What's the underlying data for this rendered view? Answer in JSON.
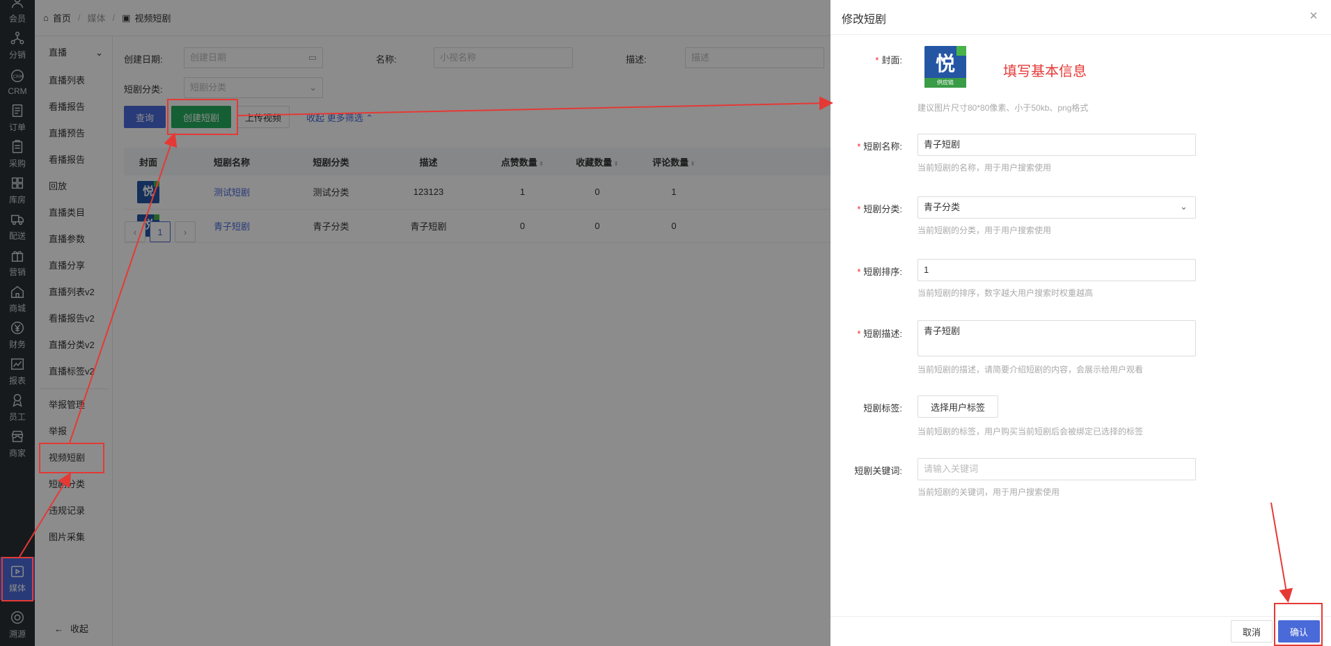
{
  "rail": {
    "items": [
      {
        "label": "会员",
        "icon": "user-icon"
      },
      {
        "label": "分销",
        "icon": "share-tree-icon"
      },
      {
        "label": "CRM",
        "icon": "crm-icon"
      },
      {
        "label": "订单",
        "icon": "order-icon"
      },
      {
        "label": "采购",
        "icon": "purchase-icon"
      },
      {
        "label": "库房",
        "icon": "warehouse-icon"
      },
      {
        "label": "配送",
        "icon": "truck-icon"
      },
      {
        "label": "营销",
        "icon": "gift-icon"
      },
      {
        "label": "商城",
        "icon": "home-icon"
      },
      {
        "label": "财务",
        "icon": "yen-icon"
      },
      {
        "label": "报表",
        "icon": "chart-icon"
      },
      {
        "label": "员工",
        "icon": "employee-icon"
      },
      {
        "label": "商家",
        "icon": "store-icon"
      },
      {
        "label": "媒体",
        "icon": "play-icon"
      },
      {
        "label": "溯源",
        "icon": "trace-icon"
      }
    ]
  },
  "breadcrumb": {
    "home": "首页",
    "media": "媒体",
    "current": "视频短剧"
  },
  "submenu": {
    "group_live": "直播",
    "live_items": [
      "直播列表",
      "看播报告",
      "直播预告",
      "看播报告",
      "回放",
      "直播类目",
      "直播参数",
      "直播分享",
      "直播列表v2",
      "看播报告v2",
      "直播分类v2",
      "直播标签v2"
    ],
    "other_items": [
      "举报管理",
      "举报",
      "视频短剧",
      "短剧分类",
      "违规记录",
      "图片采集"
    ],
    "collapse": "收起"
  },
  "filters": {
    "date_label": "创建日期:",
    "date_placeholder": "创建日期",
    "name_label": "名称:",
    "name_placeholder": "小视名称",
    "desc_label": "描述:",
    "desc_placeholder": "描述",
    "cat_label": "短剧分类:",
    "cat_placeholder": "短剧分类"
  },
  "actions": {
    "query": "查询",
    "create": "创建短剧",
    "upload": "上传视频",
    "collapse_more": "收起 更多筛选"
  },
  "table": {
    "headers": [
      "封面",
      "短剧名称",
      "短剧分类",
      "描述",
      "点赞数量",
      "收藏数量",
      "评论数量"
    ],
    "rows": [
      {
        "cover": "悦",
        "name": "测试短剧",
        "category": "测试分类",
        "desc": "123123",
        "likes": "1",
        "favs": "0",
        "comments": "1"
      },
      {
        "cover": "悦",
        "name": "青子短剧",
        "category": "青子分类",
        "desc": "青子短剧",
        "likes": "0",
        "favs": "0",
        "comments": "0"
      }
    ]
  },
  "pager": {
    "current": "1",
    "prev": "‹",
    "next": "›"
  },
  "drawer": {
    "title": "修改短剧",
    "cover_label": "封面:",
    "cover_char": "悦",
    "cover_band": "供应链",
    "cover_help": "建议图片尺寸80*80像素、小于50kb、png格式",
    "annotation": "填写基本信息",
    "name_label": "短剧名称:",
    "name_value": "青子短剧",
    "name_help": "当前短剧的名称，用于用户搜索使用",
    "cat_label": "短剧分类:",
    "cat_value": "青子分类",
    "cat_help": "当前短剧的分类，用于用户搜索使用",
    "sort_label": "短剧排序:",
    "sort_value": "1",
    "sort_help": "当前短剧的排序，数字越大用户搜索时权重越高",
    "desc_label": "短剧描述:",
    "desc_value": "青子短剧",
    "desc_help": "当前短剧的描述，请简要介绍短剧的内容，会展示给用户观看",
    "tag_label": "短剧标签:",
    "tag_button": "选择用户标签",
    "tag_help": "当前短剧的标签，用户购买当前短剧后会被绑定已选择的标签",
    "kw_label": "短剧关键词:",
    "kw_placeholder": "请输入关键词",
    "kw_help": "当前短剧的关键词，用于用户搜索使用",
    "cancel": "取消",
    "confirm": "确认"
  },
  "colors": {
    "primary": "#4a6ad9",
    "green": "#27ae60",
    "annotation": "#e53935"
  }
}
